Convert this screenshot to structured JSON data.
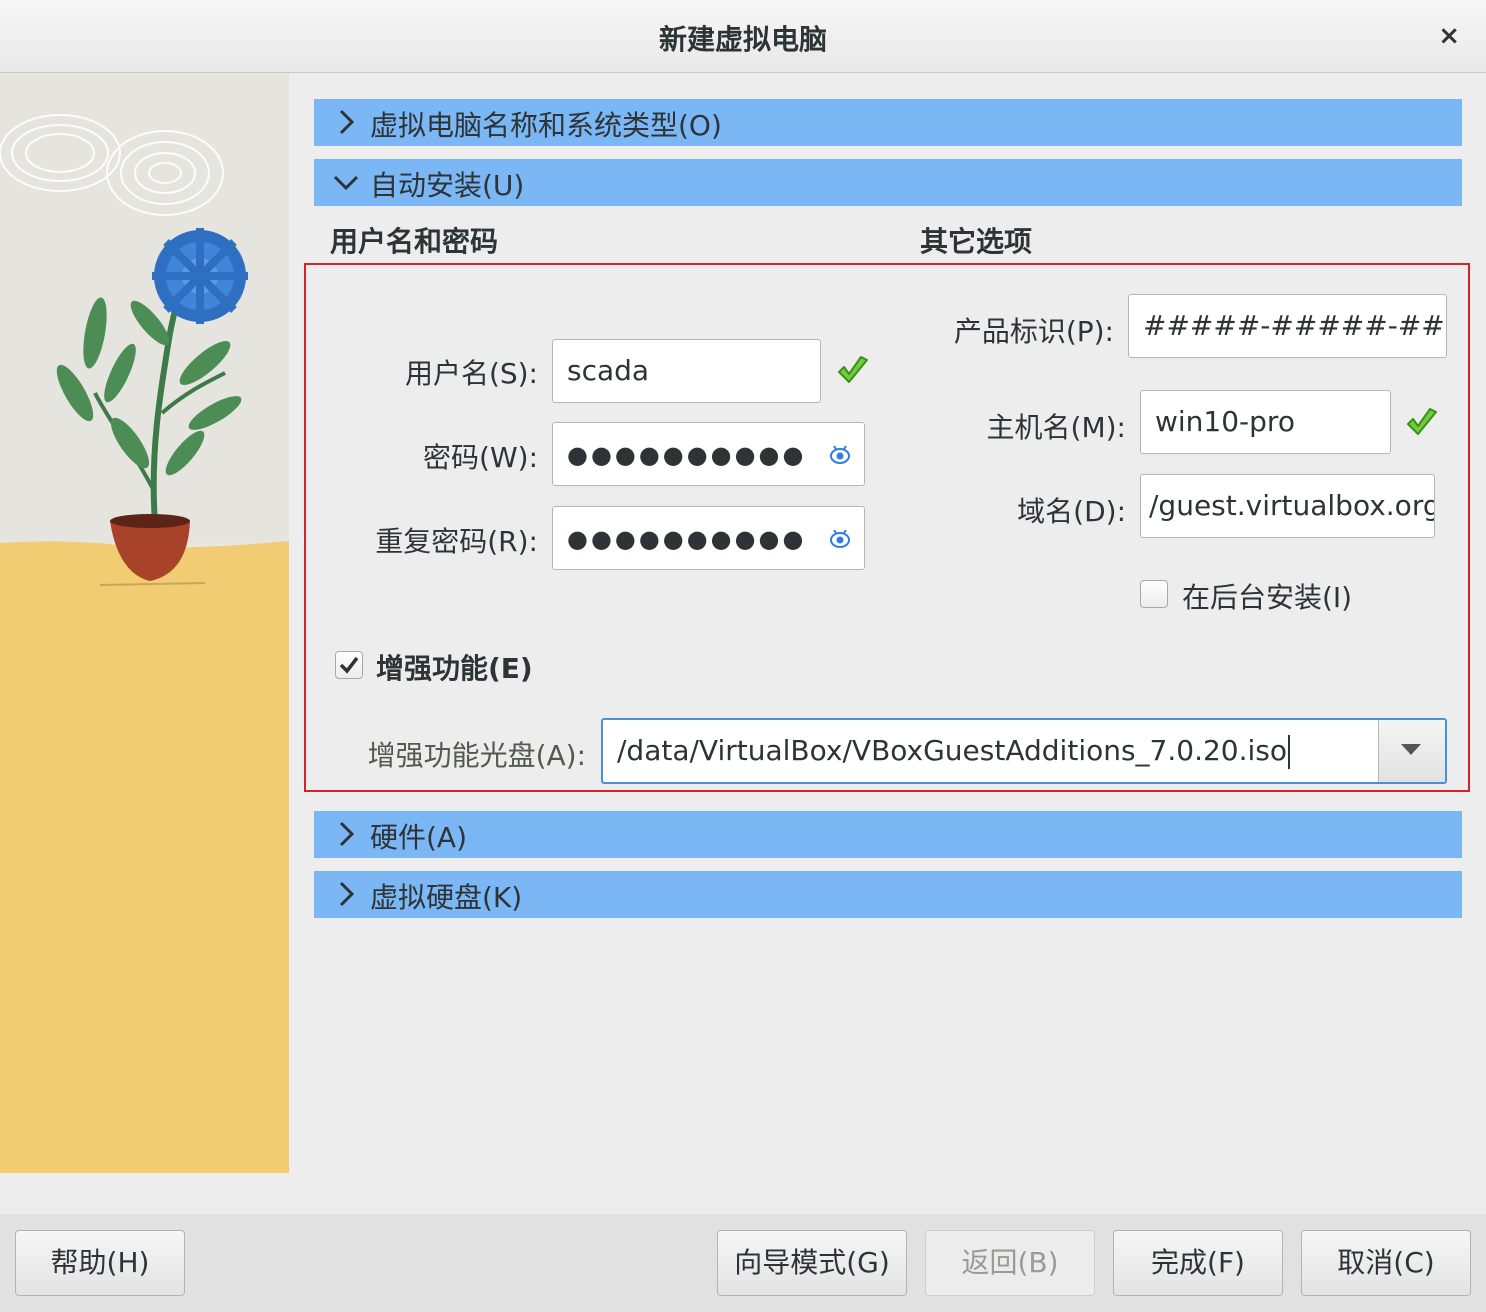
{
  "window": {
    "title": "新建虚拟电脑",
    "close_glyph": "×"
  },
  "sections": {
    "name_os": "虚拟电脑名称和系统类型(O)",
    "unattended": "自动安装(U)",
    "hardware": "硬件(A)",
    "disk": "虚拟硬盘(K)"
  },
  "unattended": {
    "user_group_title": "用户名和密码",
    "other_group_title": "其它选项",
    "username_label": "用户名(S):",
    "username_value": "scada",
    "password_label": "密码(W):",
    "password_value": "●●●●●●●●●●",
    "repeat_password_label": "重复密码(R):",
    "repeat_password_value": "●●●●●●●●●●",
    "product_key_label": "产品标识(P):",
    "product_key_value": "#####-#####-###",
    "hostname_label": "主机名(M):",
    "hostname_value": "win10-pro",
    "domain_label": "域名(D):",
    "domain_value": "/guest.virtualbox.org",
    "background_install_label": "在后台安装(I)",
    "background_install_checked": false,
    "guest_additions_label": "增强功能(E)",
    "guest_additions_checked": true,
    "guest_additions_iso_label": "增强功能光盘(A):",
    "guest_additions_iso_value": "/data/VirtualBox/VBoxGuestAdditions_7.0.20.iso"
  },
  "buttons": {
    "help": "帮助(H)",
    "guided_mode": "向导模式(G)",
    "back": "返回(B)",
    "finish": "完成(F)",
    "cancel": "取消(C)"
  },
  "colors": {
    "section_header": "#7bb7f5",
    "highlight_border": "#d8202a",
    "valid_check": "#4caf2a",
    "focus_border": "#4a90d9"
  },
  "icons": {
    "expand": "chevron-right-icon",
    "collapse": "chevron-down-icon",
    "valid": "green-check-icon",
    "reveal": "eye-icon",
    "dropdown": "triangle-down-icon"
  }
}
